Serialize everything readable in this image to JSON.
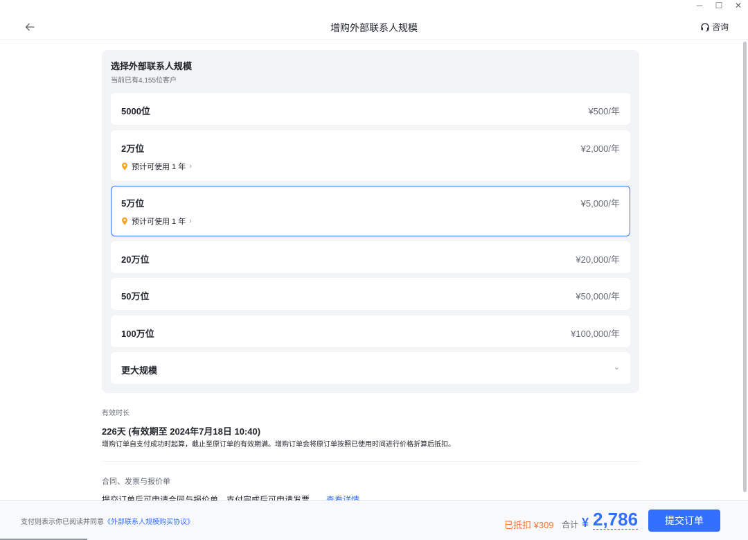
{
  "window": {
    "minimize": "─",
    "maximize": "☐",
    "close": "✕"
  },
  "header": {
    "title": "增购外部联系人规模",
    "consult_label": "咨询"
  },
  "panel": {
    "title": "选择外部联系人规模",
    "subtitle": "当前已有4,155位客户",
    "options": [
      {
        "name": "5000位",
        "price": "¥500/年"
      },
      {
        "name": "2万位",
        "price": "¥2,000/年",
        "note": "预计可使用 1 年"
      },
      {
        "name": "5万位",
        "price": "¥5,000/年",
        "note": "预计可使用 1 年",
        "selected": true
      },
      {
        "name": "20万位",
        "price": "¥20,000/年"
      },
      {
        "name": "50万位",
        "price": "¥50,000/年"
      },
      {
        "name": "100万位",
        "price": "¥100,000/年"
      },
      {
        "name": "更大规模"
      }
    ]
  },
  "validity": {
    "label": "有效时长",
    "value": "226天 (有效期至 2024年7月18日 10:40)",
    "description": "增购订单自支付成功时起算，截止至原订单的有效期满。增购订单会将原订单按照已使用时间进行价格折算后抵扣。"
  },
  "contract": {
    "label": "合同、发票与报价单",
    "description": "提交订单后可申请合同与报价单，支付完成后可申请发票。",
    "link": "查看详情"
  },
  "footer": {
    "agree_text": "支付则表示你已阅读并同意",
    "agree_link": "《外部联系人规模购买协议》",
    "deduct_text": "已抵扣 ¥309",
    "total_label": "合计",
    "currency": "¥",
    "total_amount": "2,786",
    "submit_label": "提交订单"
  },
  "colors": {
    "accent": "#3370ff",
    "deduct": "#f77234",
    "pin": "#f5a623"
  }
}
